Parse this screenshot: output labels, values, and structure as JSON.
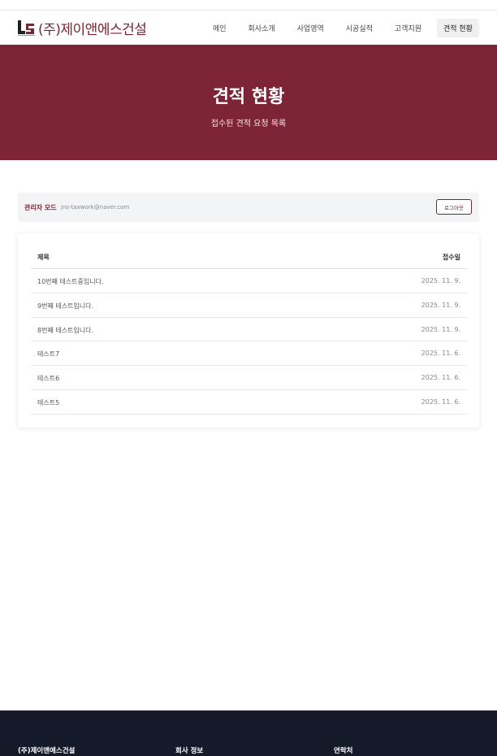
{
  "header": {
    "logo_text": "(주)제이앤에스건설",
    "nav": [
      {
        "label": "메인",
        "active": false
      },
      {
        "label": "회사소개",
        "active": false
      },
      {
        "label": "사업영역",
        "active": false
      },
      {
        "label": "시공실적",
        "active": false
      },
      {
        "label": "고객지원",
        "active": false
      },
      {
        "label": "견적 현황",
        "active": true
      }
    ]
  },
  "hero": {
    "title": "견적 현황",
    "subtitle": "접수된 견적 요청 목록"
  },
  "admin": {
    "label": "관리자 모드",
    "email": "jns-taxwork@naver.com",
    "logout_label": "로그아웃"
  },
  "table": {
    "col_title": "제목",
    "col_date": "접수일",
    "rows": [
      {
        "title": "10번째 테스트중입니다.",
        "date": "2025. 11. 9."
      },
      {
        "title": "9번째 테스트입니다.",
        "date": "2025. 11. 9."
      },
      {
        "title": "8번째 테스트입니다.",
        "date": "2025. 11. 9."
      },
      {
        "title": "테스트7",
        "date": "2025. 11. 6."
      },
      {
        "title": "테스트6",
        "date": "2025. 11. 6."
      },
      {
        "title": "테스트5",
        "date": "2025. 11. 6."
      }
    ]
  },
  "footer": {
    "company": "(주)제이앤에스건설",
    "info": "회사 정보",
    "contact": "연락처"
  },
  "colors": {
    "brand": "#7d2436",
    "footer_bg": "#141a2a"
  }
}
